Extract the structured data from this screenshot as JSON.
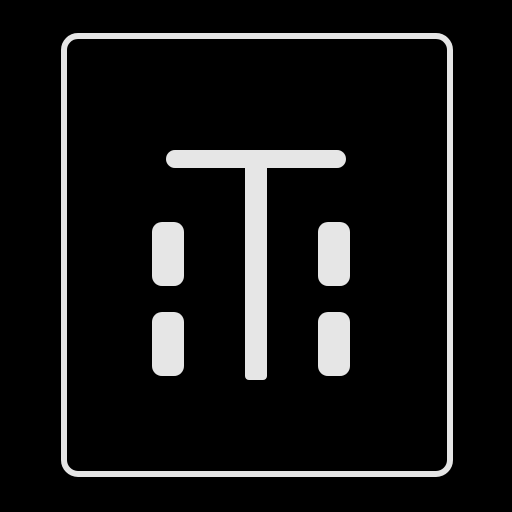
{
  "icon": {
    "name": "text-field-icon",
    "stroke_color": "#e6e6e6",
    "background_color": "#000000"
  }
}
